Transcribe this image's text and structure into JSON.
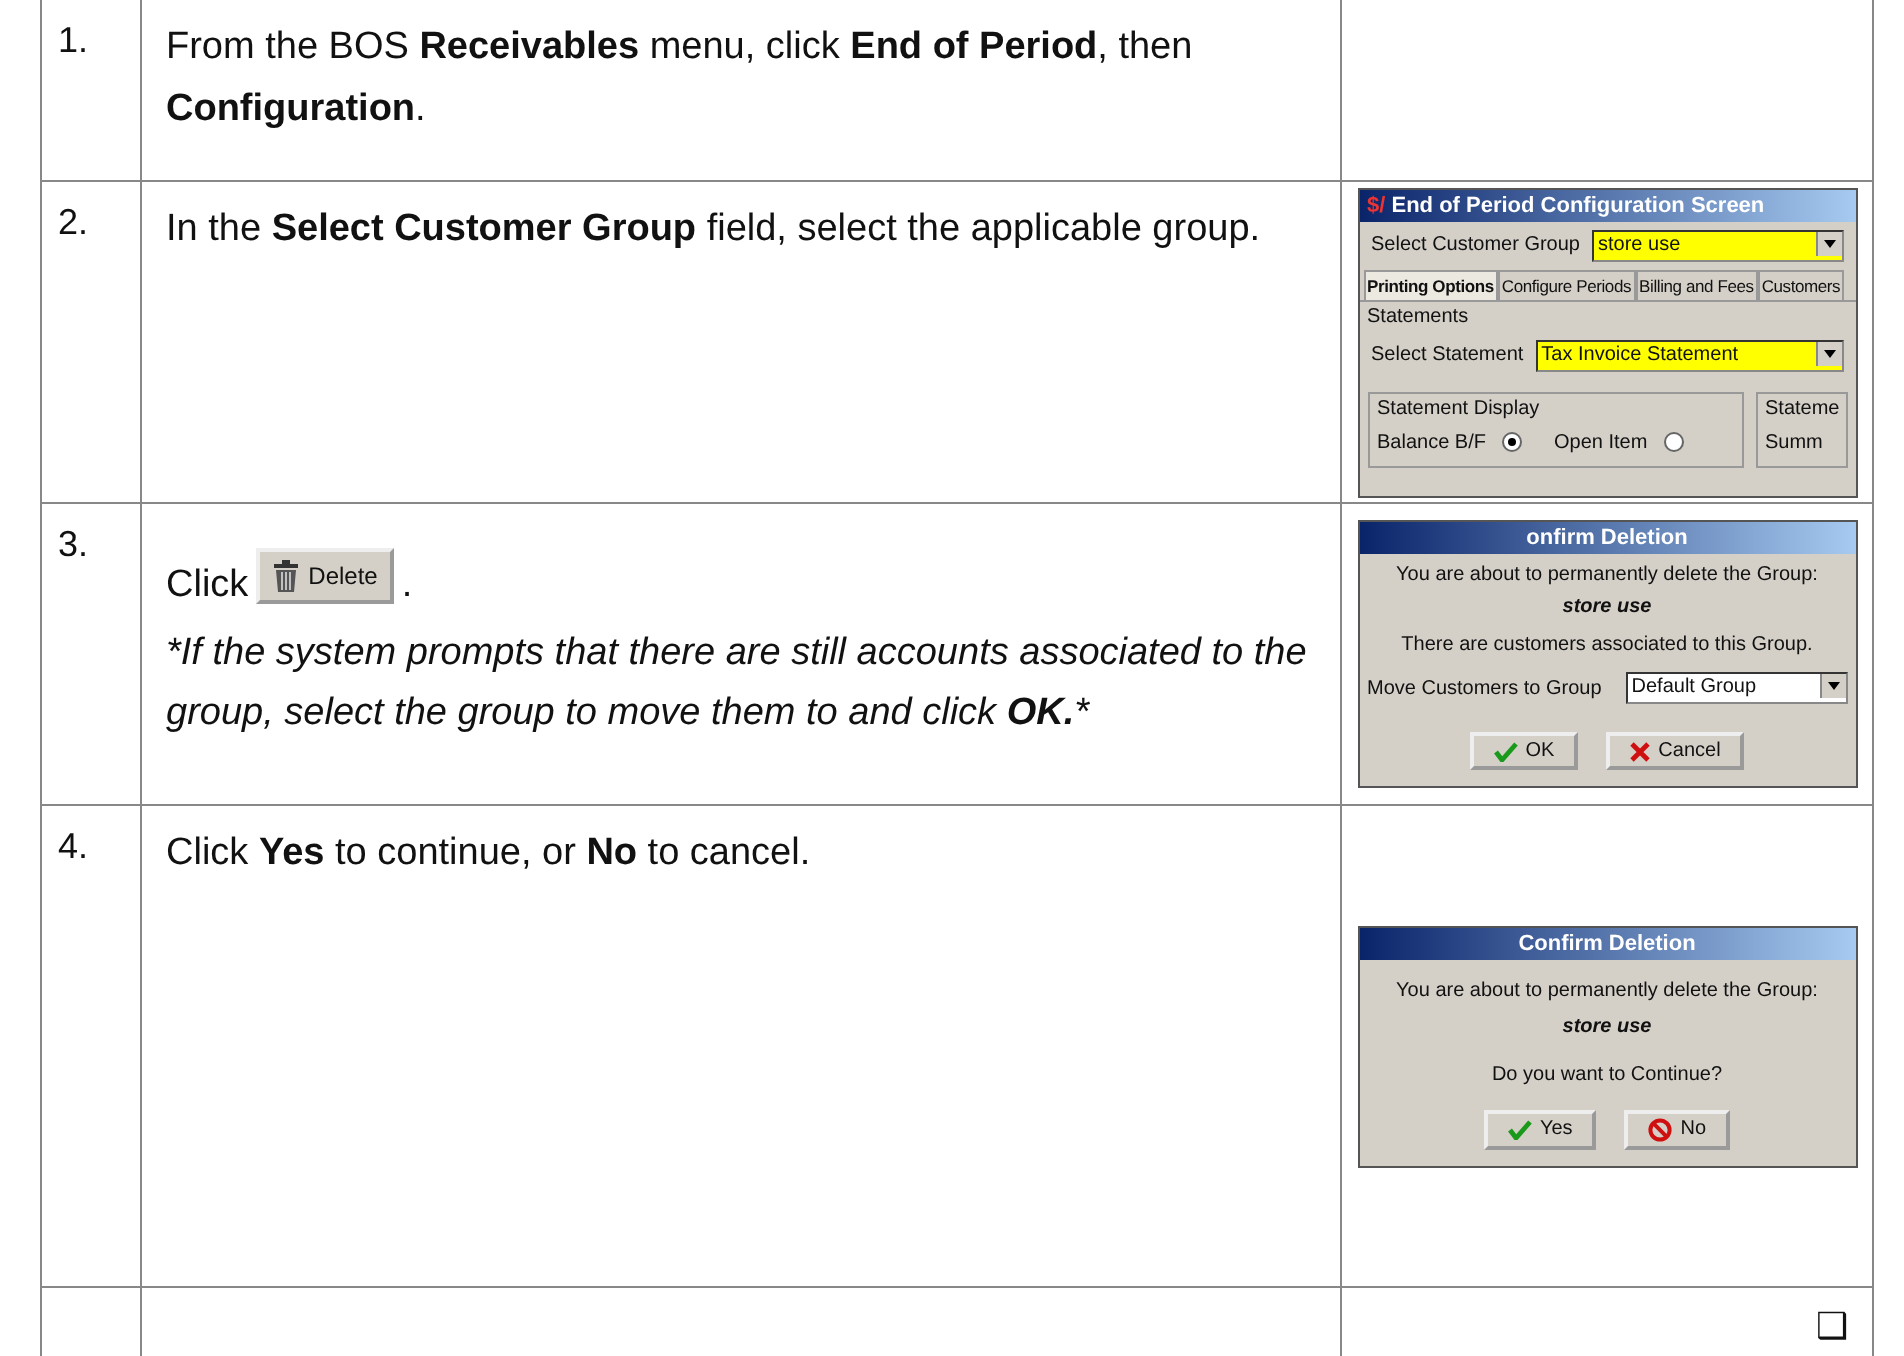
{
  "steps": [
    {
      "number": "1.",
      "text": "From the BOS **Receivables** menu, click **End of Period**, then **Configuration**."
    },
    {
      "number": "2.",
      "text": "In the **Select Customer Group** field, select the applicable group.",
      "screenshot": {
        "kind": "config",
        "logo": "$/",
        "title": "End of Period Configuration Screen",
        "group_label": "Select Customer Group",
        "group_value": "store use",
        "tabs": [
          {
            "label": "Printing Options",
            "selected": true
          },
          {
            "label": "Configure Periods",
            "selected": false
          },
          {
            "label": "Billing and Fees",
            "selected": false
          },
          {
            "label": "Customers",
            "selected": false
          }
        ],
        "section": "Statements",
        "statement_label": "Select Statement",
        "statement_value": "Tax Invoice Statement",
        "display_label": "Statement Display",
        "options": [
          {
            "label": "Balance B/F",
            "selected": true
          },
          {
            "label": "Open Item",
            "selected": false
          }
        ],
        "side_label": "Stateme",
        "side_text": "Summ"
      }
    },
    {
      "number": "3.",
      "text": "Click",
      "inline_button": "Delete",
      "text_after": ".",
      "note_before": "*If the system prompts that there are still accounts associated to the group, select the group to move them to and click ",
      "note_bold": "OK.",
      "note_after": "*",
      "screenshot": {
        "kind": "move",
        "title": "onfirm Deletion",
        "message": "You are about to permanently delete the Group:",
        "group": "store use",
        "detail": "There are customers associated to this Group.",
        "move_label": "Move Customers to Group",
        "move_value": "Default Group",
        "buttons": [
          {
            "label": "OK",
            "kind": "ok"
          },
          {
            "label": "Cancel",
            "kind": "cancel"
          }
        ]
      }
    },
    {
      "number": "4.",
      "text": "Click **Yes** to continue, or **No** to cancel.",
      "screenshot": {
        "kind": "confirm",
        "title": "Confirm Deletion",
        "message": "You are about to permanently delete the Group:",
        "group": "store use",
        "detail": "Do you want to Continue?",
        "buttons": [
          {
            "label": "Yes",
            "kind": "ok"
          },
          {
            "label": "No",
            "kind": "no"
          }
        ]
      }
    },
    {
      "checkbox": "❑"
    }
  ]
}
